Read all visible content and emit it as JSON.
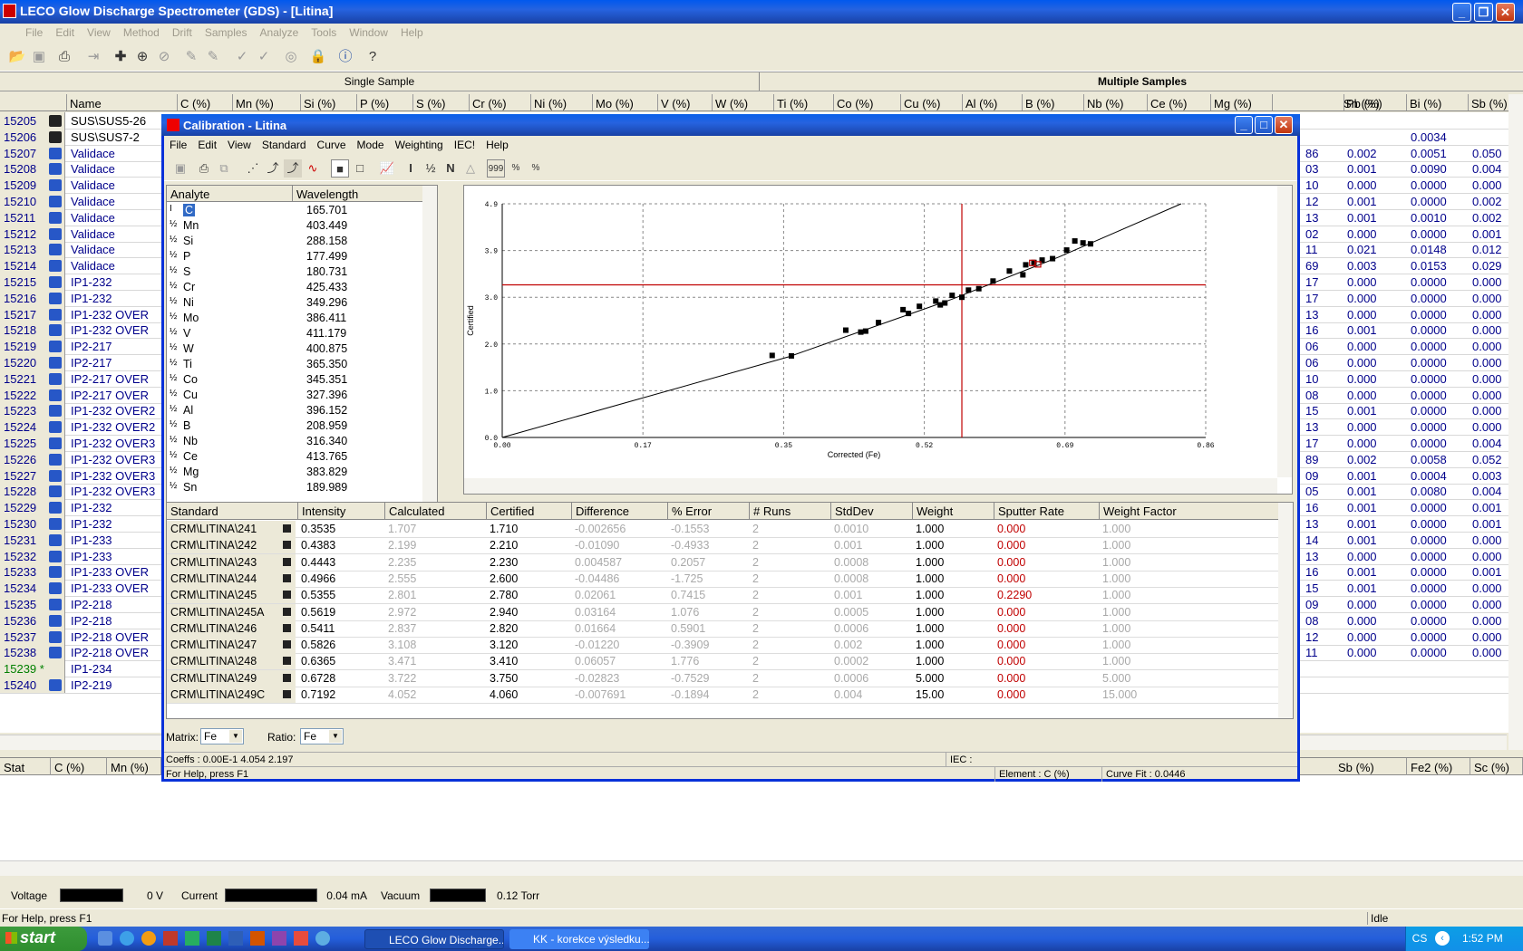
{
  "app": {
    "title": "LECO Glow Discharge Spectrometer (GDS) - [Litina]",
    "menu": [
      "File",
      "Edit",
      "View",
      "Method",
      "Drift",
      "Samples",
      "Analyze",
      "Tools",
      "Window",
      "Help"
    ],
    "tabs": [
      "Single Sample",
      "Multiple Samples"
    ]
  },
  "grid": {
    "headers": [
      "Name",
      "C (%)",
      "Mn (%)",
      "Si (%)",
      "P (%)",
      "S (%)",
      "Cr (%)",
      "Ni (%)",
      "Mo (%)",
      "V (%)",
      "W (%)",
      "Ti (%)",
      "Co (%)",
      "Cu (%)",
      "Al (%)",
      "B (%)",
      "Nb (%)",
      "Ce (%)",
      "Mg (%)",
      "Sn (%)",
      "Pb (%)",
      "Bi (%)",
      "Sb (%)"
    ],
    "rows": [
      {
        "id": "15205",
        "name": "SUS\\SUS5-26",
        "sn": "",
        "pb": "",
        "bi": "",
        "sb": ""
      },
      {
        "id": "15206",
        "name": "SUS\\SUS7-2",
        "sn": "",
        "pb": "",
        "bi": "0.0034",
        "sb": ""
      },
      {
        "id": "15207",
        "name": "Validace",
        "sn": "86",
        "pb": "0.002",
        "bi": "0.0051",
        "sb": "0.050"
      },
      {
        "id": "15208",
        "name": "Validace",
        "sn": "03",
        "pb": "0.001",
        "bi": "0.0090",
        "sb": "0.004"
      },
      {
        "id": "15209",
        "name": "Validace",
        "sn": "10",
        "pb": "0.000",
        "bi": "0.0000",
        "sb": "0.000"
      },
      {
        "id": "15210",
        "name": "Validace",
        "sn": "12",
        "pb": "0.001",
        "bi": "0.0000",
        "sb": "0.002"
      },
      {
        "id": "15211",
        "name": "Validace",
        "sn": "13",
        "pb": "0.001",
        "bi": "0.0010",
        "sb": "0.002"
      },
      {
        "id": "15212",
        "name": "Validace",
        "sn": "02",
        "pb": "0.000",
        "bi": "0.0000",
        "sb": "0.001"
      },
      {
        "id": "15213",
        "name": "Validace",
        "sn": "11",
        "pb": "0.021",
        "bi": "0.0148",
        "sb": "0.012"
      },
      {
        "id": "15214",
        "name": "Validace",
        "sn": "69",
        "pb": "0.003",
        "bi": "0.0153",
        "sb": "0.029"
      },
      {
        "id": "15215",
        "name": "IP1-232",
        "sn": "17",
        "pb": "0.000",
        "bi": "0.0000",
        "sb": "0.000"
      },
      {
        "id": "15216",
        "name": "IP1-232",
        "sn": "17",
        "pb": "0.000",
        "bi": "0.0000",
        "sb": "0.000"
      },
      {
        "id": "15217",
        "name": "IP1-232 OVER",
        "sn": "13",
        "pb": "0.000",
        "bi": "0.0000",
        "sb": "0.000"
      },
      {
        "id": "15218",
        "name": "IP1-232 OVER",
        "sn": "16",
        "pb": "0.001",
        "bi": "0.0000",
        "sb": "0.000"
      },
      {
        "id": "15219",
        "name": "IP2-217",
        "sn": "06",
        "pb": "0.000",
        "bi": "0.0000",
        "sb": "0.000"
      },
      {
        "id": "15220",
        "name": "IP2-217",
        "sn": "06",
        "pb": "0.000",
        "bi": "0.0000",
        "sb": "0.000"
      },
      {
        "id": "15221",
        "name": "IP2-217 OVER",
        "sn": "10",
        "pb": "0.000",
        "bi": "0.0000",
        "sb": "0.000"
      },
      {
        "id": "15222",
        "name": "IP2-217 OVER",
        "sn": "08",
        "pb": "0.000",
        "bi": "0.0000",
        "sb": "0.000"
      },
      {
        "id": "15223",
        "name": "IP1-232 OVER2",
        "sn": "15",
        "pb": "0.001",
        "bi": "0.0000",
        "sb": "0.000"
      },
      {
        "id": "15224",
        "name": "IP1-232 OVER2",
        "sn": "13",
        "pb": "0.000",
        "bi": "0.0000",
        "sb": "0.000"
      },
      {
        "id": "15225",
        "name": "IP1-232 OVER3",
        "sn": "17",
        "pb": "0.000",
        "bi": "0.0000",
        "sb": "0.004"
      },
      {
        "id": "15226",
        "name": "IP1-232 OVER3",
        "sn": "89",
        "pb": "0.002",
        "bi": "0.0058",
        "sb": "0.052"
      },
      {
        "id": "15227",
        "name": "IP1-232 OVER3",
        "sn": "09",
        "pb": "0.001",
        "bi": "0.0004",
        "sb": "0.003"
      },
      {
        "id": "15228",
        "name": "IP1-232 OVER3",
        "sn": "05",
        "pb": "0.001",
        "bi": "0.0080",
        "sb": "0.004"
      },
      {
        "id": "15229",
        "name": "IP1-232",
        "sn": "16",
        "pb": "0.001",
        "bi": "0.0000",
        "sb": "0.001"
      },
      {
        "id": "15230",
        "name": "IP1-232",
        "sn": "13",
        "pb": "0.001",
        "bi": "0.0000",
        "sb": "0.001"
      },
      {
        "id": "15231",
        "name": "IP1-233",
        "sn": "14",
        "pb": "0.001",
        "bi": "0.0000",
        "sb": "0.000"
      },
      {
        "id": "15232",
        "name": "IP1-233",
        "sn": "13",
        "pb": "0.000",
        "bi": "0.0000",
        "sb": "0.000"
      },
      {
        "id": "15233",
        "name": "IP1-233 OVER",
        "sn": "16",
        "pb": "0.001",
        "bi": "0.0000",
        "sb": "0.001"
      },
      {
        "id": "15234",
        "name": "IP1-233 OVER",
        "sn": "15",
        "pb": "0.001",
        "bi": "0.0000",
        "sb": "0.000"
      },
      {
        "id": "15235",
        "name": "IP2-218",
        "sn": "09",
        "pb": "0.000",
        "bi": "0.0000",
        "sb": "0.000"
      },
      {
        "id": "15236",
        "name": "IP2-218",
        "sn": "08",
        "pb": "0.000",
        "bi": "0.0000",
        "sb": "0.000"
      },
      {
        "id": "15237",
        "name": "IP2-218 OVER",
        "sn": "12",
        "pb": "0.000",
        "bi": "0.0000",
        "sb": "0.000"
      },
      {
        "id": "15238",
        "name": "IP2-218 OVER",
        "sn": "11",
        "pb": "0.000",
        "bi": "0.0000",
        "sb": "0.000"
      },
      {
        "id": "15239 *",
        "name": "IP1-234",
        "sn": "",
        "pb": "",
        "bi": "",
        "sb": ""
      },
      {
        "id": "15240",
        "name": "IP2-219",
        "sn": "",
        "pb": "",
        "bi": "",
        "sb": ""
      }
    ]
  },
  "stats": {
    "headers": [
      "Stat",
      "C (%)",
      "Mn (%)",
      "Sb (%)",
      "Fe2 (%)",
      "Sc (%)"
    ]
  },
  "status": {
    "voltage_label": "Voltage",
    "voltage_value": "0 V",
    "current_label": "Current",
    "current_value": "0.04 mA",
    "vacuum_label": "Vacuum",
    "vacuum_value": "0.12 Torr",
    "help": "For Help, press F1",
    "state": "Idle"
  },
  "taskbar": {
    "start": "start",
    "tasks": [
      "LECO Glow Discharge...",
      "KK - korekce výsledku..."
    ],
    "lang": "CS",
    "time": "1:52 PM"
  },
  "dialog": {
    "title": "Calibration - Litina",
    "menu": [
      "File",
      "Edit",
      "View",
      "Standard",
      "Curve",
      "Mode",
      "Weighting",
      "IEC!",
      "Help"
    ],
    "analyte_headers": [
      "Analyte",
      "Wavelength"
    ],
    "analytes": [
      {
        "name": "C",
        "wl": "165.701"
      },
      {
        "name": "Mn",
        "wl": "403.449"
      },
      {
        "name": "Si",
        "wl": "288.158"
      },
      {
        "name": "P",
        "wl": "177.499"
      },
      {
        "name": "S",
        "wl": "180.731"
      },
      {
        "name": "Cr",
        "wl": "425.433"
      },
      {
        "name": "Ni",
        "wl": "349.296"
      },
      {
        "name": "Mo",
        "wl": "386.411"
      },
      {
        "name": "V",
        "wl": "411.179"
      },
      {
        "name": "W",
        "wl": "400.875"
      },
      {
        "name": "Ti",
        "wl": "365.350"
      },
      {
        "name": "Co",
        "wl": "345.351"
      },
      {
        "name": "Cu",
        "wl": "327.396"
      },
      {
        "name": "Al",
        "wl": "396.152"
      },
      {
        "name": "B",
        "wl": "208.959"
      },
      {
        "name": "Nb",
        "wl": "316.340"
      },
      {
        "name": "Ce",
        "wl": "413.765"
      },
      {
        "name": "Mg",
        "wl": "383.829"
      },
      {
        "name": "Sn",
        "wl": "189.989"
      }
    ],
    "std_headers": [
      "Standard",
      "Intensity",
      "Calculated",
      "Certified",
      "Difference",
      "% Error",
      "# Runs",
      "StdDev",
      "Weight",
      "Sputter Rate",
      "Weight Factor"
    ],
    "standards": [
      [
        "CRM\\LITINA\\241",
        "0.3535",
        "1.707",
        "1.710",
        "-0.002656",
        "-0.1553",
        "2",
        "0.0010",
        "1.000",
        "0.000",
        "1.000"
      ],
      [
        "CRM\\LITINA\\242",
        "0.4383",
        "2.199",
        "2.210",
        "-0.01090",
        "-0.4933",
        "2",
        "0.001",
        "1.000",
        "0.000",
        "1.000"
      ],
      [
        "CRM\\LITINA\\243",
        "0.4443",
        "2.235",
        "2.230",
        "0.004587",
        "0.2057",
        "2",
        "0.0008",
        "1.000",
        "0.000",
        "1.000"
      ],
      [
        "CRM\\LITINA\\244",
        "0.4966",
        "2.555",
        "2.600",
        "-0.04486",
        "-1.725",
        "2",
        "0.0008",
        "1.000",
        "0.000",
        "1.000"
      ],
      [
        "CRM\\LITINA\\245",
        "0.5355",
        "2.801",
        "2.780",
        "0.02061",
        "0.7415",
        "2",
        "0.001",
        "1.000",
        "0.2290",
        "1.000"
      ],
      [
        "CRM\\LITINA\\245A",
        "0.5619",
        "2.972",
        "2.940",
        "0.03164",
        "1.076",
        "2",
        "0.0005",
        "1.000",
        "0.000",
        "1.000"
      ],
      [
        "CRM\\LITINA\\246",
        "0.5411",
        "2.837",
        "2.820",
        "0.01664",
        "0.5901",
        "2",
        "0.0006",
        "1.000",
        "0.000",
        "1.000"
      ],
      [
        "CRM\\LITINA\\247",
        "0.5826",
        "3.108",
        "3.120",
        "-0.01220",
        "-0.3909",
        "2",
        "0.002",
        "1.000",
        "0.000",
        "1.000"
      ],
      [
        "CRM\\LITINA\\248",
        "0.6365",
        "3.471",
        "3.410",
        "0.06057",
        "1.776",
        "2",
        "0.0002",
        "1.000",
        "0.000",
        "1.000"
      ],
      [
        "CRM\\LITINA\\249",
        "0.6728",
        "3.722",
        "3.750",
        "-0.02823",
        "-0.7529",
        "2",
        "0.0006",
        "5.000",
        "0.000",
        "5.000"
      ],
      [
        "CRM\\LITINA\\249C",
        "0.7192",
        "4.052",
        "4.060",
        "-0.007691",
        "-0.1894",
        "2",
        "0.004",
        "15.00",
        "0.000",
        "15.000"
      ]
    ],
    "matrix_label": "Matrix:",
    "matrix_value": "Fe",
    "ratio_label": "Ratio:",
    "ratio_value": "Fe",
    "coeffs": "Coeffs : 0.00E-1  4.054  2.197",
    "iec": "IEC :",
    "help": "For Help, press F1",
    "element": "Element : C (%)",
    "curvefit": "Curve Fit : 0.0446"
  },
  "chart_data": {
    "type": "scatter",
    "xlabel": "Corrected (Fe)",
    "ylabel": "Certified",
    "xlim": [
      0.0,
      0.86
    ],
    "ylim": [
      0.0,
      4.9
    ],
    "xticks": [
      "0.00",
      "0.17",
      "0.35",
      "0.52",
      "0.69",
      "0.86"
    ],
    "yticks": [
      "0.0",
      "1.0",
      "2.0",
      "3.0",
      "3.9",
      "4.9"
    ],
    "crosshair": {
      "x": 0.5619,
      "y": 3.2,
      "color": "#C00000"
    },
    "fit_line": [
      [
        0.0,
        0.0
      ],
      [
        0.35,
        1.69
      ],
      [
        0.55,
        2.9
      ],
      [
        0.68,
        3.78
      ],
      [
        0.83,
        4.9
      ]
    ],
    "points": [
      [
        0.3535,
        1.71
      ],
      [
        0.4383,
        2.21
      ],
      [
        0.4443,
        2.23
      ],
      [
        0.4966,
        2.6
      ],
      [
        0.5355,
        2.78
      ],
      [
        0.5619,
        2.94
      ],
      [
        0.5411,
        2.82
      ],
      [
        0.5826,
        3.12
      ],
      [
        0.6365,
        3.41
      ],
      [
        0.6728,
        3.75
      ],
      [
        0.7192,
        4.06
      ],
      [
        0.33,
        1.72
      ],
      [
        0.42,
        2.25
      ],
      [
        0.46,
        2.41
      ],
      [
        0.49,
        2.68
      ],
      [
        0.51,
        2.75
      ],
      [
        0.53,
        2.86
      ],
      [
        0.55,
        2.98
      ],
      [
        0.57,
        3.09
      ],
      [
        0.6,
        3.28
      ],
      [
        0.62,
        3.49
      ],
      [
        0.64,
        3.62
      ],
      [
        0.65,
        3.67
      ],
      [
        0.66,
        3.72
      ],
      [
        0.69,
        3.93
      ],
      [
        0.7,
        4.12
      ],
      [
        0.71,
        4.08
      ]
    ],
    "highlight_points": [
      [
        0.648,
        3.66
      ],
      [
        0.655,
        3.63
      ]
    ],
    "grid": true
  }
}
